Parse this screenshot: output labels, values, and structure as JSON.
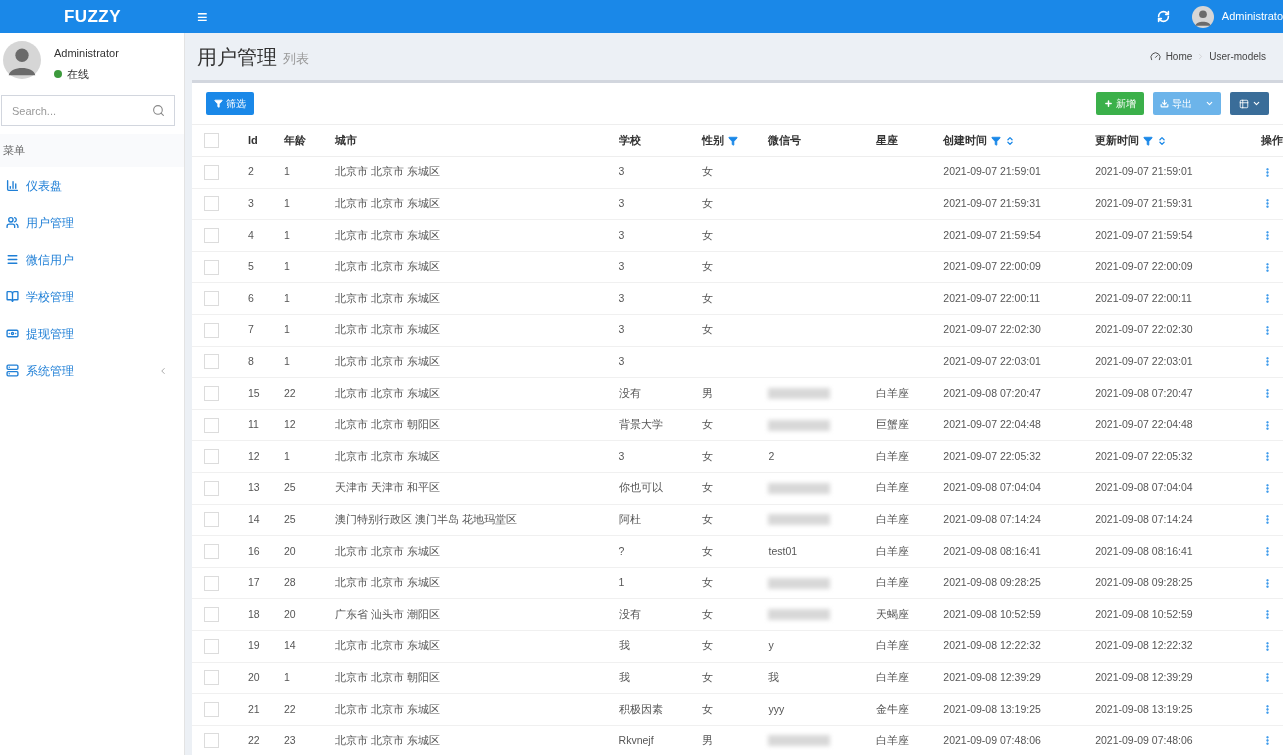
{
  "topbar": {
    "brand": "FUZZY",
    "menu_toggle": "≡",
    "user": "Administrato"
  },
  "sidebar": {
    "user": {
      "name": "Administrator",
      "status": "在线"
    },
    "search": {
      "placeholder": "Search..."
    },
    "section": "菜单",
    "items": [
      {
        "label": "仪表盘",
        "expandable": false
      },
      {
        "label": "用户管理",
        "expandable": false
      },
      {
        "label": "微信用户",
        "expandable": false
      },
      {
        "label": "学校管理",
        "expandable": false
      },
      {
        "label": "提现管理",
        "expandable": false
      },
      {
        "label": "系统管理",
        "expandable": true
      }
    ]
  },
  "page": {
    "title": "用户管理",
    "subtitle": "列表",
    "breadcrumb": [
      "Home",
      "User-models"
    ]
  },
  "toolbar": {
    "filter": "筛选",
    "create": "新增",
    "export": "导出"
  },
  "table": {
    "all_checked": false,
    "columns": [
      {
        "label": "Id",
        "filter": false,
        "sort": false
      },
      {
        "label": "年龄",
        "filter": false,
        "sort": false
      },
      {
        "label": "城市",
        "filter": false,
        "sort": false
      },
      {
        "label": "学校",
        "filter": false,
        "sort": false
      },
      {
        "label": "性别",
        "filter": true,
        "sort": false
      },
      {
        "label": "微信号",
        "filter": false,
        "sort": false
      },
      {
        "label": "星座",
        "filter": false,
        "sort": false
      },
      {
        "label": "创建时间",
        "filter": true,
        "sort": true
      },
      {
        "label": "更新时间",
        "filter": true,
        "sort": true
      },
      {
        "label": "操作",
        "filter": false,
        "sort": false
      }
    ],
    "rows": [
      {
        "id": "2",
        "age": "1",
        "city": "北京市 北京市 东城区",
        "school": "3",
        "gender": "女",
        "wechat": "",
        "wechat_blurred": false,
        "sign": "",
        "created": "2021-09-07 21:59:01",
        "updated": "2021-09-07 21:59:01",
        "checked": false
      },
      {
        "id": "3",
        "age": "1",
        "city": "北京市 北京市 东城区",
        "school": "3",
        "gender": "女",
        "wechat": "",
        "wechat_blurred": false,
        "sign": "",
        "created": "2021-09-07 21:59:31",
        "updated": "2021-09-07 21:59:31",
        "checked": false
      },
      {
        "id": "4",
        "age": "1",
        "city": "北京市 北京市 东城区",
        "school": "3",
        "gender": "女",
        "wechat": "",
        "wechat_blurred": false,
        "sign": "",
        "created": "2021-09-07 21:59:54",
        "updated": "2021-09-07 21:59:54",
        "checked": false
      },
      {
        "id": "5",
        "age": "1",
        "city": "北京市 北京市 东城区",
        "school": "3",
        "gender": "女",
        "wechat": "",
        "wechat_blurred": false,
        "sign": "",
        "created": "2021-09-07 22:00:09",
        "updated": "2021-09-07 22:00:09",
        "checked": false
      },
      {
        "id": "6",
        "age": "1",
        "city": "北京市 北京市 东城区",
        "school": "3",
        "gender": "女",
        "wechat": "",
        "wechat_blurred": false,
        "sign": "",
        "created": "2021-09-07 22:00:11",
        "updated": "2021-09-07 22:00:11",
        "checked": false
      },
      {
        "id": "7",
        "age": "1",
        "city": "北京市 北京市 东城区",
        "school": "3",
        "gender": "女",
        "wechat": "",
        "wechat_blurred": false,
        "sign": "",
        "created": "2021-09-07 22:02:30",
        "updated": "2021-09-07 22:02:30",
        "checked": false
      },
      {
        "id": "8",
        "age": "1",
        "city": "北京市 北京市 东城区",
        "school": "3",
        "gender": "",
        "wechat": "",
        "wechat_blurred": false,
        "sign": "",
        "created": "2021-09-07 22:03:01",
        "updated": "2021-09-07 22:03:01",
        "checked": false
      },
      {
        "id": "15",
        "age": "22",
        "city": "北京市 北京市 东城区",
        "school": "没有",
        "gender": "男",
        "wechat": "",
        "wechat_blurred": true,
        "sign": "白羊座",
        "created": "2021-09-08 07:20:47",
        "updated": "2021-09-08 07:20:47",
        "checked": false
      },
      {
        "id": "11",
        "age": "12",
        "city": "北京市 北京市 朝阳区",
        "school": "背景大学",
        "gender": "女",
        "wechat": "",
        "wechat_blurred": true,
        "sign": "巨蟹座",
        "created": "2021-09-07 22:04:48",
        "updated": "2021-09-07 22:04:48",
        "checked": false
      },
      {
        "id": "12",
        "age": "1",
        "city": "北京市 北京市 东城区",
        "school": "3",
        "gender": "女",
        "wechat": "2",
        "wechat_blurred": false,
        "sign": "白羊座",
        "created": "2021-09-07 22:05:32",
        "updated": "2021-09-07 22:05:32",
        "checked": false
      },
      {
        "id": "13",
        "age": "25",
        "city": "天津市 天津市 和平区",
        "school": "你也可以",
        "gender": "女",
        "wechat": "",
        "wechat_blurred": true,
        "sign": "白羊座",
        "created": "2021-09-08 07:04:04",
        "updated": "2021-09-08 07:04:04",
        "checked": false
      },
      {
        "id": "14",
        "age": "25",
        "city": "澳门特别行政区 澳门半岛 花地玛堂区",
        "school": "阿杜",
        "gender": "女",
        "wechat": "",
        "wechat_blurred": true,
        "sign": "白羊座",
        "created": "2021-09-08 07:14:24",
        "updated": "2021-09-08 07:14:24",
        "checked": false
      },
      {
        "id": "16",
        "age": "20",
        "city": "北京市 北京市 东城区",
        "school": "?",
        "gender": "女",
        "wechat": "test01",
        "wechat_blurred": false,
        "sign": "白羊座",
        "created": "2021-09-08 08:16:41",
        "updated": "2021-09-08 08:16:41",
        "checked": false
      },
      {
        "id": "17",
        "age": "28",
        "city": "北京市 北京市 东城区",
        "school": "1",
        "gender": "女",
        "wechat": "",
        "wechat_blurred": true,
        "sign": "白羊座",
        "created": "2021-09-08 09:28:25",
        "updated": "2021-09-08 09:28:25",
        "checked": false
      },
      {
        "id": "18",
        "age": "20",
        "city": "广东省 汕头市 潮阳区",
        "school": "没有",
        "gender": "女",
        "wechat": "",
        "wechat_blurred": true,
        "sign": "天蝎座",
        "created": "2021-09-08 10:52:59",
        "updated": "2021-09-08 10:52:59",
        "checked": false
      },
      {
        "id": "19",
        "age": "14",
        "city": "北京市 北京市 东城区",
        "school": "我",
        "gender": "女",
        "wechat": "y",
        "wechat_blurred": false,
        "sign": "白羊座",
        "created": "2021-09-08 12:22:32",
        "updated": "2021-09-08 12:22:32",
        "checked": false
      },
      {
        "id": "20",
        "age": "1",
        "city": "北京市 北京市 朝阳区",
        "school": "我",
        "gender": "女",
        "wechat": "我",
        "wechat_blurred": false,
        "sign": "白羊座",
        "created": "2021-09-08 12:39:29",
        "updated": "2021-09-08 12:39:29",
        "checked": false
      },
      {
        "id": "21",
        "age": "22",
        "city": "北京市 北京市 东城区",
        "school": "积极因素",
        "gender": "女",
        "wechat": "yyy",
        "wechat_blurred": false,
        "sign": "金牛座",
        "created": "2021-09-08 13:19:25",
        "updated": "2021-09-08 13:19:25",
        "checked": false
      },
      {
        "id": "22",
        "age": "23",
        "city": "北京市 北京市 东城区",
        "school": "Rkvnejf",
        "gender": "男",
        "wechat": "",
        "wechat_blurred": true,
        "sign": "白羊座",
        "created": "2021-09-09 07:48:06",
        "updated": "2021-09-09 07:48:06",
        "checked": false
      }
    ]
  }
}
